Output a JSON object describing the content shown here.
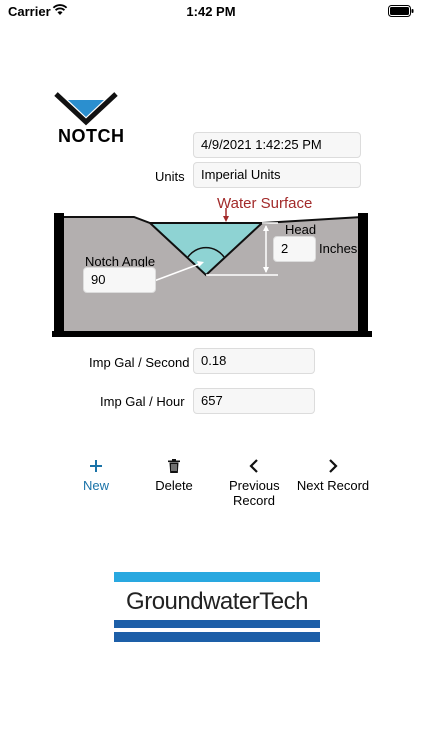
{
  "status_bar": {
    "carrier": "Carrier",
    "time": "1:42 PM"
  },
  "logo": {
    "text": "NOTCH"
  },
  "record": {
    "timestamp": "4/9/2021 1:42:25 PM",
    "units_label": "Units",
    "units_value": "Imperial Units"
  },
  "diagram": {
    "water_surface_label": "Water Surface",
    "head_label": "Head",
    "head_value": "2",
    "head_unit": "Inches",
    "notch_angle_label": "Notch Angle",
    "notch_angle_value": "90"
  },
  "results": {
    "flow_second_label": "Imp Gal / Second",
    "flow_second_value": "0.18",
    "flow_hour_label": "Imp Gal  / Hour",
    "flow_hour_value": "657"
  },
  "toolbar": {
    "new_label": "New",
    "delete_label": "Delete",
    "previous_label": "Previous Record",
    "next_label": "Next Record"
  },
  "brand": {
    "name": "GroundwaterTech"
  },
  "colors": {
    "accent": "#1a73a8",
    "water": "#8ed3d3",
    "ground": "#b3afaf",
    "water_surface_text": "#a22a2a",
    "brand_light_blue": "#29a8e0",
    "brand_dark_blue": "#1d5fa8"
  }
}
